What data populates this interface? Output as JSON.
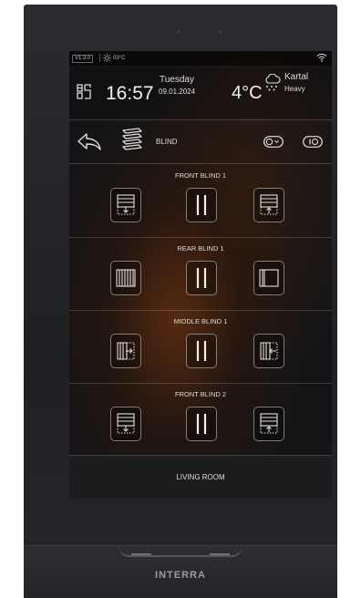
{
  "status": {
    "version": "V1.3.0",
    "inner_temp": "03°C",
    "wifi_icon": "wifi-icon",
    "sun_icon": "sun-icon"
  },
  "weather": {
    "time": "16:57",
    "day": "Tuesday",
    "date": "09.01.2024",
    "temperature": "4°C",
    "city": "Kartal",
    "condition": "Heavy"
  },
  "toolbar": {
    "mode_label": "BLIND"
  },
  "blinds": [
    {
      "label": "FRONT BLIND 1",
      "icons": [
        "blind-down-icon",
        "pause-icon",
        "blind-up-icon"
      ]
    },
    {
      "label": "REAR BLIND 1",
      "icons": [
        "blind-closed-icon",
        "pause-icon",
        "blind-open-icon"
      ]
    },
    {
      "label": "MIDDLE BLIND 1",
      "icons": [
        "blind-right-icon",
        "pause-icon",
        "blind-left-icon"
      ]
    },
    {
      "label": "FRONT BLIND 2",
      "icons": [
        "blind-down-icon",
        "pause-icon",
        "blind-up-icon"
      ]
    }
  ],
  "room": {
    "label": "LIVING ROOM"
  },
  "brand": {
    "name": "INTERRA"
  },
  "colors": {
    "bezel": "#232428",
    "screen_bg": "#141416",
    "text": "#e8e8e8",
    "accent_fire": "#8c3c0a"
  }
}
